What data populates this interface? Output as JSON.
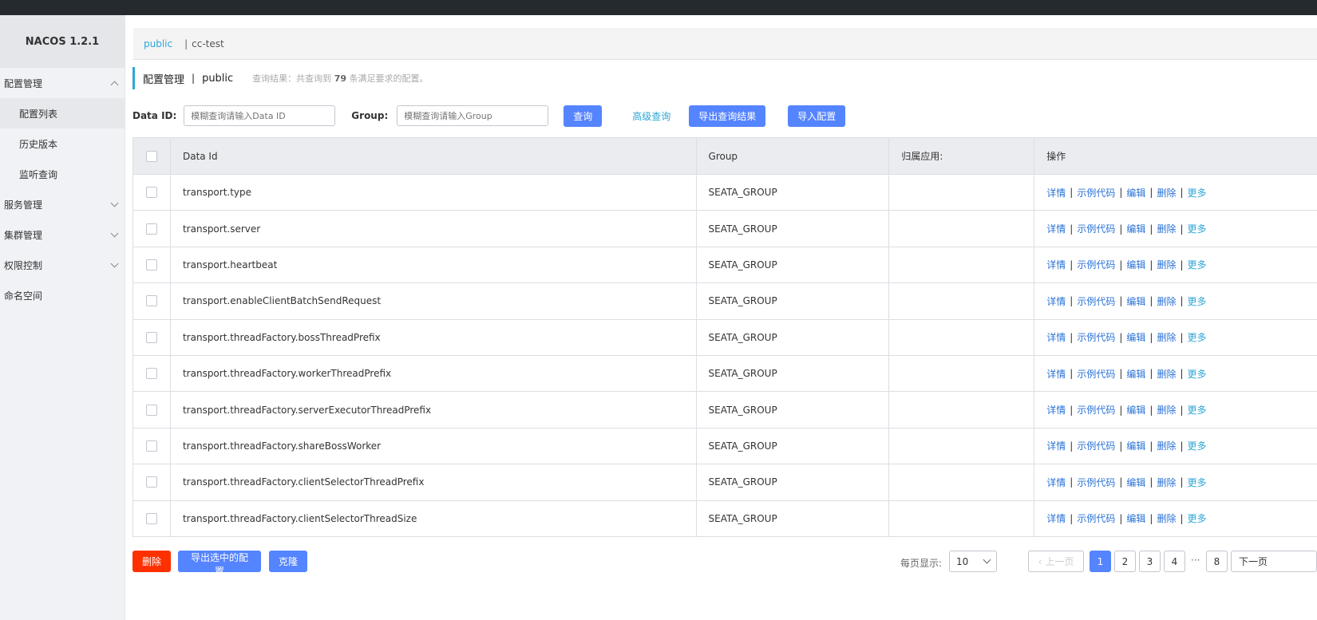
{
  "app": {
    "brand": "NACOS 1.2.1"
  },
  "sidebar": {
    "groups": [
      {
        "label": "配置管理",
        "expanded": true,
        "items": [
          "配置列表",
          "历史版本",
          "监听查询"
        ]
      },
      {
        "label": "服务管理",
        "expanded": false
      },
      {
        "label": "集群管理",
        "expanded": false
      },
      {
        "label": "权限控制",
        "expanded": false
      },
      {
        "label": "命名空间"
      }
    ],
    "active_item": "配置列表"
  },
  "namespaces": {
    "items": [
      "public",
      "cc-test"
    ],
    "active": "public"
  },
  "header": {
    "title": "配置管理",
    "separator": "|",
    "namespace": "public",
    "summary_prefix": "查询结果：共查询到",
    "summary_count": "79",
    "summary_suffix": "条满足要求的配置。"
  },
  "filter": {
    "data_id_label": "Data ID:",
    "data_id_placeholder": "模糊查询请输入Data ID",
    "group_label": "Group:",
    "group_placeholder": "模糊查询请输入Group",
    "query_button": "查询",
    "advanced_link": "高级查询",
    "export_button": "导出查询结果",
    "import_button": "导入配置"
  },
  "table": {
    "columns": [
      "Data Id",
      "Group",
      "归属应用:",
      "操作"
    ],
    "actions": [
      "详情",
      "示例代码",
      "编辑",
      "删除",
      "更多"
    ],
    "rows": [
      {
        "data_id": "transport.type",
        "group": "SEATA_GROUP",
        "app": ""
      },
      {
        "data_id": "transport.server",
        "group": "SEATA_GROUP",
        "app": ""
      },
      {
        "data_id": "transport.heartbeat",
        "group": "SEATA_GROUP",
        "app": ""
      },
      {
        "data_id": "transport.enableClientBatchSendRequest",
        "group": "SEATA_GROUP",
        "app": ""
      },
      {
        "data_id": "transport.threadFactory.bossThreadPrefix",
        "group": "SEATA_GROUP",
        "app": ""
      },
      {
        "data_id": "transport.threadFactory.workerThreadPrefix",
        "group": "SEATA_GROUP",
        "app": ""
      },
      {
        "data_id": "transport.threadFactory.serverExecutorThreadPrefix",
        "group": "SEATA_GROUP",
        "app": ""
      },
      {
        "data_id": "transport.threadFactory.shareBossWorker",
        "group": "SEATA_GROUP",
        "app": ""
      },
      {
        "data_id": "transport.threadFactory.clientSelectorThreadPrefix",
        "group": "SEATA_GROUP",
        "app": ""
      },
      {
        "data_id": "transport.threadFactory.clientSelectorThreadSize",
        "group": "SEATA_GROUP",
        "app": ""
      }
    ]
  },
  "footer": {
    "delete_button": "删除",
    "export_selected_button": "导出选中的配置",
    "clone_button": "克隆",
    "page_size_label": "每页显示:",
    "page_size": "10",
    "prev_label": "上一页",
    "pages": [
      "1",
      "2",
      "3",
      "4"
    ],
    "ellipsis": "···",
    "last_page": "8",
    "next_label": "下一页",
    "current_page": "1"
  }
}
